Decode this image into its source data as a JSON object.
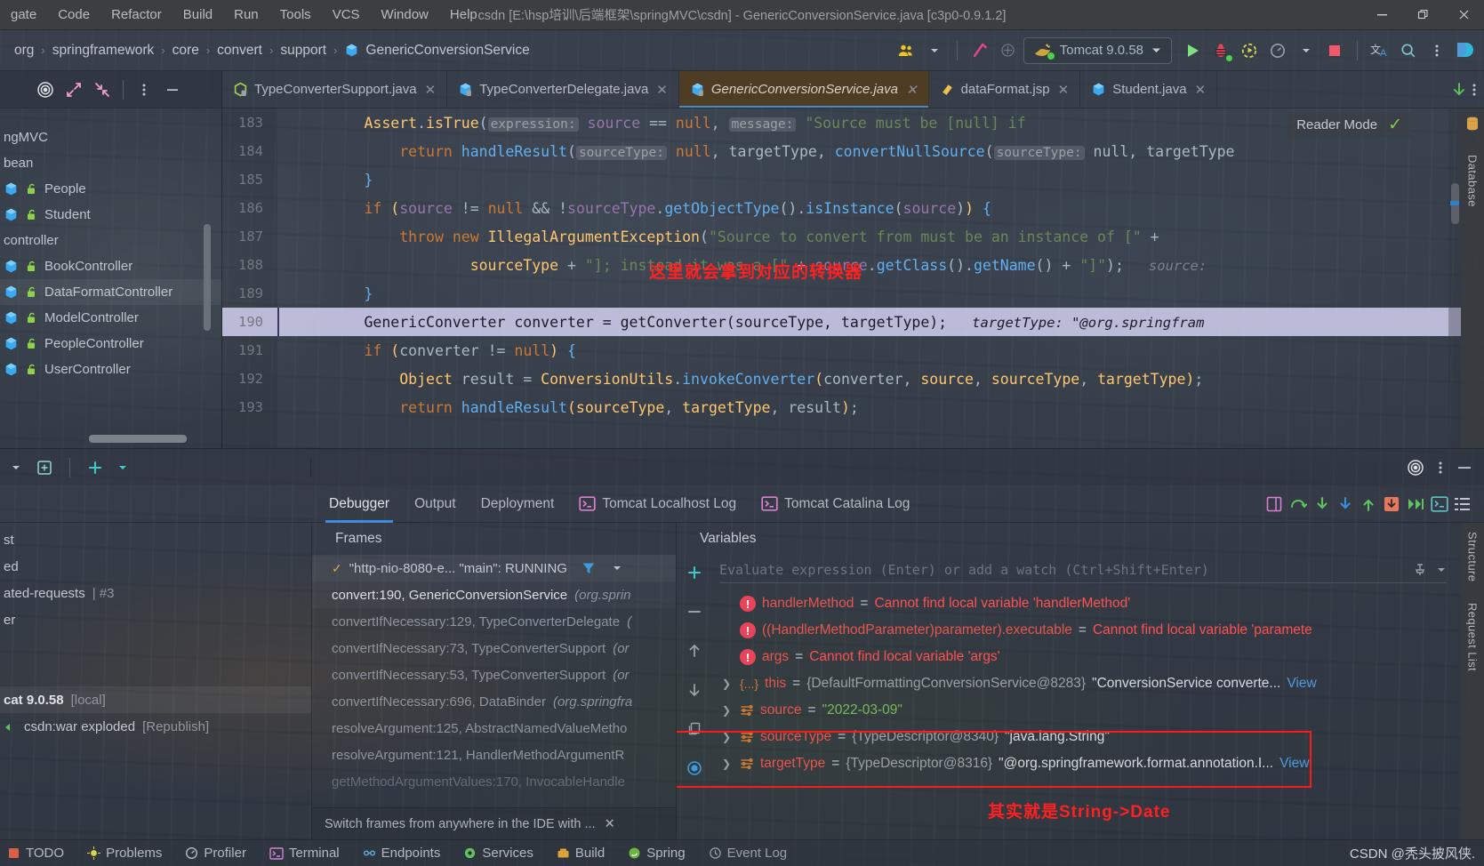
{
  "window": {
    "title": "csdn [E:\\hsp培训\\后端框架\\springMVC\\csdn] - GenericConversionService.java [c3p0-0.9.1.2]",
    "minimize": "—",
    "maximize": "❐",
    "close": "✕"
  },
  "menubar": [
    {
      "label": "gate"
    },
    {
      "label": "Code"
    },
    {
      "label": "Refactor"
    },
    {
      "label": "Build"
    },
    {
      "label": "Run"
    },
    {
      "label": "Tools"
    },
    {
      "label": "VCS"
    },
    {
      "label": "Window"
    },
    {
      "label": "Help"
    }
  ],
  "navbar": {
    "crumbs": [
      "org",
      "springframework",
      "core",
      "convert",
      "support",
      "GenericConversionService"
    ],
    "separator": "›",
    "run_config": "Tomcat 9.0.58",
    "icons": [
      "people-icon",
      "chevron-down-icon",
      "hammer-build-icon",
      "run-icon",
      "debug-icon",
      "run-with-coverage-icon",
      "profiler-icon",
      "chevron-down-icon",
      "stop-icon",
      "translate-icon",
      "search-icon",
      "more-vertical-icon",
      "ide-logo-icon"
    ]
  },
  "tool_strip": [
    "target-icon",
    "expand-icon",
    "collapse-icon",
    "more-vertical-icon",
    "minimize-icon"
  ],
  "editor_tabs": [
    {
      "label": "TypeConverterSupport.java",
      "icon": "java-class-icon-green",
      "active": false
    },
    {
      "label": "TypeConverterDelegate.java",
      "icon": "java-class-icon-blue",
      "active": false
    },
    {
      "label": "GenericConversionService.java",
      "icon": "java-class-icon-blue",
      "active": true
    },
    {
      "label": "dataFormat.jsp",
      "icon": "jsp-file-icon",
      "active": false
    },
    {
      "label": "Student.java",
      "icon": "java-class-icon-blue",
      "active": false
    }
  ],
  "tabs_right_icons": [
    "download-arrow-icon",
    "more-vertical-icon"
  ],
  "project_tree": [
    {
      "label": "ngMVC",
      "kind": "folder-partial",
      "indent": 0
    },
    {
      "label": "bean",
      "kind": "folder-partial",
      "indent": 0
    },
    {
      "label": "People",
      "kind": "class",
      "indent": 1
    },
    {
      "label": "Student",
      "kind": "class",
      "indent": 1
    },
    {
      "label": "controller",
      "kind": "folder-partial",
      "indent": 0
    },
    {
      "label": "BookController",
      "kind": "class",
      "indent": 1
    },
    {
      "label": "DataFormatController",
      "kind": "class",
      "indent": 1,
      "selected": true
    },
    {
      "label": "ModelController",
      "kind": "class",
      "indent": 1
    },
    {
      "label": "PeopleController",
      "kind": "class",
      "indent": 1
    },
    {
      "label": "UserController",
      "kind": "class",
      "indent": 1
    }
  ],
  "editor": {
    "reader_mode_label": "Reader Mode",
    "reader_mode_check": "✓",
    "right_labels": [
      "Database"
    ],
    "annotation_1": "这里就会拿到对应的转换器",
    "lines": [
      {
        "num": "183",
        "segments": [
          {
            "t": "        ",
            "c": "t"
          },
          {
            "t": "Assert",
            "c": "m"
          },
          {
            "t": ".",
            "c": "t"
          },
          {
            "t": "isTrue",
            "c": "m"
          },
          {
            "t": "(",
            "c": "t"
          },
          {
            "t": "expression:",
            "c": "hint"
          },
          {
            "t": " ",
            "c": "t"
          },
          {
            "t": "source",
            "c": "kk"
          },
          {
            "t": " == ",
            "c": "t"
          },
          {
            "t": "null",
            "c": "k"
          },
          {
            "t": ", ",
            "c": "t"
          },
          {
            "t": "message:",
            "c": "hint"
          },
          {
            "t": " ",
            "c": "t"
          },
          {
            "t": "\"Source must be [null] if ",
            "c": "s"
          }
        ]
      },
      {
        "num": "184",
        "segments": [
          {
            "t": "            ",
            "c": "t"
          },
          {
            "t": "return",
            "c": "k"
          },
          {
            "t": " ",
            "c": "t"
          },
          {
            "t": "handleResult",
            "c": "fn"
          },
          {
            "t": "(",
            "c": "t"
          },
          {
            "t": "sourceType:",
            "c": "hint"
          },
          {
            "t": " ",
            "c": "t"
          },
          {
            "t": "null",
            "c": "k"
          },
          {
            "t": ", ",
            "c": "t"
          },
          {
            "t": "targetType",
            "c": "t"
          },
          {
            "t": ", ",
            "c": "t"
          },
          {
            "t": "convertNullSource",
            "c": "fn"
          },
          {
            "t": "(",
            "c": "t"
          },
          {
            "t": "sourceType:",
            "c": "hint"
          },
          {
            "t": " null, targetType",
            "c": "t"
          }
        ]
      },
      {
        "num": "185",
        "segments": [
          {
            "t": "        ",
            "c": "t"
          },
          {
            "t": "}",
            "c": "fn"
          }
        ]
      },
      {
        "num": "186",
        "segments": [
          {
            "t": "        ",
            "c": "t"
          },
          {
            "t": "if",
            "c": "k"
          },
          {
            "t": " ",
            "c": "t"
          },
          {
            "t": "(",
            "c": "m"
          },
          {
            "t": "source",
            "c": "kk"
          },
          {
            "t": " != ",
            "c": "t"
          },
          {
            "t": "null",
            "c": "k"
          },
          {
            "t": " && ",
            "c": "t"
          },
          {
            "t": "!",
            "c": "t"
          },
          {
            "t": "sourceType",
            "c": "kk"
          },
          {
            "t": ".",
            "c": "t"
          },
          {
            "t": "getObjectType",
            "c": "fn"
          },
          {
            "t": "()",
            "c": "t"
          },
          {
            "t": ".",
            "c": "t"
          },
          {
            "t": "isInstance",
            "c": "fn"
          },
          {
            "t": "(",
            "c": "t"
          },
          {
            "t": "source",
            "c": "kk"
          },
          {
            "t": ")",
            "c": "t"
          },
          {
            "t": ")",
            "c": "m"
          },
          {
            "t": " {",
            "c": "fn"
          }
        ]
      },
      {
        "num": "187",
        "segments": [
          {
            "t": "            ",
            "c": "t"
          },
          {
            "t": "throw",
            "c": "k"
          },
          {
            "t": " ",
            "c": "t"
          },
          {
            "t": "new",
            "c": "k"
          },
          {
            "t": " ",
            "c": "t"
          },
          {
            "t": "IllegalArgumentException",
            "c": "m"
          },
          {
            "t": "(",
            "c": "t"
          },
          {
            "t": "\"Source to convert from must be an instance of [\"",
            "c": "s"
          },
          {
            "t": " +",
            "c": "t"
          }
        ]
      },
      {
        "num": "188",
        "segments": [
          {
            "t": "                    ",
            "c": "t"
          },
          {
            "t": "sourceType",
            "c": "m"
          },
          {
            "t": " + ",
            "c": "t"
          },
          {
            "t": "\"]; instead it was a [\"",
            "c": "s"
          },
          {
            "t": " + ",
            "c": "t"
          },
          {
            "t": "source",
            "c": "kk"
          },
          {
            "t": ".",
            "c": "t"
          },
          {
            "t": "getClass",
            "c": "fn"
          },
          {
            "t": "()",
            "c": "t"
          },
          {
            "t": ".",
            "c": "t"
          },
          {
            "t": "getName",
            "c": "fn"
          },
          {
            "t": "()",
            "c": "t"
          },
          {
            "t": " + ",
            "c": "t"
          },
          {
            "t": "\"]\"",
            "c": "s"
          },
          {
            "t": ");",
            "c": "t"
          },
          {
            "t": "   source:",
            "c": "inlay"
          }
        ]
      },
      {
        "num": "189",
        "segments": [
          {
            "t": "        ",
            "c": "t"
          },
          {
            "t": "}",
            "c": "fn"
          }
        ]
      },
      {
        "num": "190",
        "highlight": true,
        "segments": [
          {
            "t": "        ",
            "c": "t"
          },
          {
            "t": "GenericConverter converter = getConverter(sourceType, targetType);",
            "c": "t"
          },
          {
            "t": "   targetType: \"@org.springfram",
            "c": "inlay"
          }
        ]
      },
      {
        "num": "191",
        "segments": [
          {
            "t": "        ",
            "c": "t"
          },
          {
            "t": "if",
            "c": "k"
          },
          {
            "t": " ",
            "c": "t"
          },
          {
            "t": "(",
            "c": "m"
          },
          {
            "t": "converter",
            "c": "t"
          },
          {
            "t": " != ",
            "c": "t"
          },
          {
            "t": "null",
            "c": "k"
          },
          {
            "t": ")",
            "c": "m"
          },
          {
            "t": " {",
            "c": "fn"
          }
        ]
      },
      {
        "num": "192",
        "segments": [
          {
            "t": "            ",
            "c": "t"
          },
          {
            "t": "Object",
            "c": "m"
          },
          {
            "t": " result = ",
            "c": "t"
          },
          {
            "t": "ConversionUtils",
            "c": "m"
          },
          {
            "t": ".",
            "c": "t"
          },
          {
            "t": "invokeConverter",
            "c": "fn"
          },
          {
            "t": "(",
            "c": "m"
          },
          {
            "t": "converter",
            "c": "t"
          },
          {
            "t": ", ",
            "c": "t"
          },
          {
            "t": "source",
            "c": "m"
          },
          {
            "t": ", ",
            "c": "t"
          },
          {
            "t": "sourceType",
            "c": "m"
          },
          {
            "t": ", ",
            "c": "t"
          },
          {
            "t": "targetType",
            "c": "m"
          },
          {
            "t": ")",
            "c": "m"
          },
          {
            "t": ";",
            "c": "t"
          }
        ]
      },
      {
        "num": "193",
        "segments": [
          {
            "t": "            ",
            "c": "t"
          },
          {
            "t": "return",
            "c": "k"
          },
          {
            "t": " ",
            "c": "t"
          },
          {
            "t": "handleResult",
            "c": "fn"
          },
          {
            "t": "(",
            "c": "m"
          },
          {
            "t": "sourceType",
            "c": "m"
          },
          {
            "t": ", ",
            "c": "t"
          },
          {
            "t": "targetType",
            "c": "m"
          },
          {
            "t": ", ",
            "c": "t"
          },
          {
            "t": "result",
            "c": "t"
          },
          {
            "t": ")",
            "c": "m"
          },
          {
            "t": ";",
            "c": "t"
          }
        ]
      }
    ]
  },
  "debug": {
    "tabs": [
      {
        "label": "Debugger",
        "active": true
      },
      {
        "label": "Output",
        "active": false
      },
      {
        "label": "Deployment",
        "active": false
      },
      {
        "label": "Tomcat Localhost Log",
        "active": false,
        "icon": "console-icon"
      },
      {
        "label": "Tomcat Catalina Log",
        "active": false,
        "icon": "console-icon"
      }
    ],
    "tab_action_icons": [
      "layout-icon",
      "step-over-icon",
      "step-into-icon",
      "force-step-into-icon",
      "step-out-icon",
      "run-to-cursor-icon",
      "resume-icon",
      "terminal-icon",
      "threads-icon"
    ],
    "run_tree": [
      {
        "label": "st",
        "dim": false
      },
      {
        "label": "ed",
        "dim": false
      },
      {
        "label": "ated-requests",
        "suffix": "| #3",
        "dim": false
      },
      {
        "label": "er",
        "dim": false
      },
      {
        "label": "cat 9.0.58",
        "suffix": "[local]",
        "bold": true,
        "selected": true
      },
      {
        "label": "csdn:war exploded",
        "suffix": "[Republish]",
        "deploy": true
      }
    ],
    "frames": {
      "title": "Frames",
      "thread": "\"http-nio-8080-e... \"main\": RUNNING",
      "thread_check": "✓",
      "filter_icon": "filter-icon",
      "chevron_icon": "chevron-down-icon",
      "items": [
        {
          "method": "convert:190, GenericConversionService",
          "pkg": "(org.sprin",
          "current": true
        },
        {
          "method": "convertIfNecessary:129, TypeConverterDelegate",
          "pkg": "(",
          "current": false
        },
        {
          "method": "convertIfNecessary:73, TypeConverterSupport",
          "pkg": "(or",
          "current": false
        },
        {
          "method": "convertIfNecessary:53, TypeConverterSupport",
          "pkg": "(or",
          "current": false
        },
        {
          "method": "convertIfNecessary:696, DataBinder",
          "pkg": "(org.springfra",
          "current": false
        },
        {
          "method": "resolveArgument:125, AbstractNamedValueMetho",
          "pkg": "",
          "current": false
        },
        {
          "method": "resolveArgument:121, HandlerMethodArgumentR",
          "pkg": "",
          "current": false
        },
        {
          "method": "getMethodArgumentValues:170, InvocableHandle",
          "pkg": "",
          "current": false
        }
      ],
      "footer": "Switch frames from anywhere in the IDE with ...",
      "footer_close": "✕"
    },
    "variables": {
      "title": "Variables",
      "eval_placeholder": "Evaluate expression (Enter) or add a watch (Ctrl+Shift+Enter)",
      "add_icon": "plus-icon",
      "pin_icon": "pin-icon",
      "chevron_icon": "chevron-down-icon",
      "tool_icons": [
        "plus-icon",
        "minus-icon",
        "arrow-up-icon",
        "arrow-down-icon",
        "copy-icon",
        "watch-eye-icon"
      ],
      "rows": [
        {
          "type": "error",
          "name": "handlerMethod",
          "eq": "=",
          "error": "Cannot find local variable 'handlerMethod'"
        },
        {
          "type": "error",
          "name": "((HandlerMethodParameter)parameter).executable",
          "eq": "=",
          "error": "Cannot find local variable 'paramete"
        },
        {
          "type": "error",
          "name": "args",
          "eq": "=",
          "error": "Cannot find local variable 'args'"
        },
        {
          "type": "obj",
          "icon": "{...}",
          "name": "this",
          "eq": "=",
          "obj": "{DefaultFormattingConversionService@8283}",
          "val": "\"ConversionService converte...",
          "link": "View"
        },
        {
          "type": "var",
          "name": "source",
          "eq": "=",
          "str": "\"2022-03-09\""
        },
        {
          "type": "var",
          "name": "sourceType",
          "eq": "=",
          "obj": "{TypeDescriptor@8340}",
          "val": "\"java.lang.String\"",
          "boxed": true
        },
        {
          "type": "var",
          "name": "targetType",
          "eq": "=",
          "obj": "{TypeDescriptor@8316}",
          "val": "\"@org.springframework.format.annotation.I...",
          "link": "View",
          "boxed": true
        }
      ],
      "annotation_2": "其实就是String->Date"
    },
    "right_rail": [
      "Structure",
      "Request List"
    ]
  },
  "statusbar": {
    "items": [
      {
        "label": "TODO",
        "icon": "todo-icon"
      },
      {
        "label": "Problems",
        "icon": "problems-icon"
      },
      {
        "label": "Profiler",
        "icon": "profiler-icon"
      },
      {
        "label": "Terminal",
        "icon": "terminal-icon"
      },
      {
        "label": "Endpoints",
        "icon": "endpoints-icon"
      },
      {
        "label": "Services",
        "icon": "services-icon"
      },
      {
        "label": "Build",
        "icon": "build-icon"
      },
      {
        "label": "Spring",
        "icon": "spring-icon"
      },
      {
        "label": "Event Log",
        "icon": "event-log-icon"
      }
    ],
    "watermark": "CSDN @秃头披风侠."
  },
  "colors": {
    "accent_blue": "#3d8ce0",
    "error_red": "#ff5050",
    "annotation_red": "#ff2020",
    "string_green": "#6a8759",
    "keyword_orange": "#cc7832",
    "active_tab_bg": "#4e3c24"
  }
}
